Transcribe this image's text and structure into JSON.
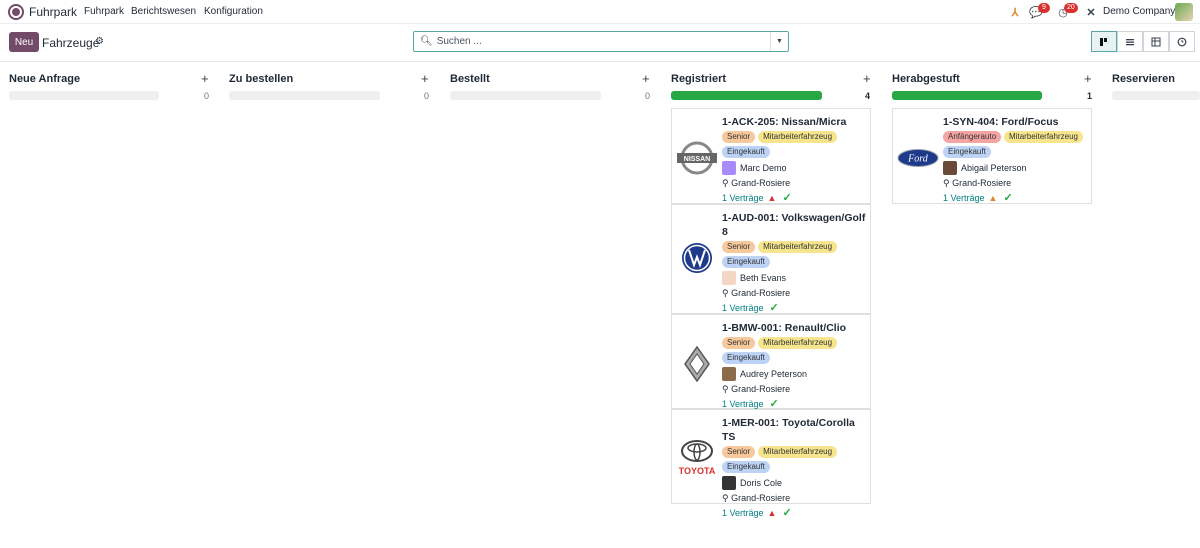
{
  "app": {
    "name": "Fuhrpark",
    "logo_icon": "steering-wheel-icon",
    "brand_color": "#714B67"
  },
  "menu": [
    "Fuhrpark",
    "Berichtswesen",
    "Konfiguration"
  ],
  "systray": {
    "messages_badge": "9",
    "activities_badge": "20",
    "company": "Demo Company"
  },
  "control_panel": {
    "new_label": "Neu",
    "title": "Fahrzeuge",
    "search_placeholder": "Suchen ..."
  },
  "columns": [
    {
      "title": "Neue Anfrage",
      "count": "0"
    },
    {
      "title": "Zu bestellen",
      "count": "0"
    },
    {
      "title": "Bestellt",
      "count": "0"
    },
    {
      "title": "Registriert",
      "count": "4"
    },
    {
      "title": "Herabgestuft",
      "count": "1"
    },
    {
      "title": "Reservieren"
    }
  ],
  "registriert_cards": [
    {
      "title": "1-ACK-205: Nissan/Micra",
      "brand": "NISSAN",
      "tags": [
        "Senior",
        "Mitarbeiterfahrzeug",
        "Eingekauft"
      ],
      "driver": "Marc Demo",
      "location": "Grand-Rosiere",
      "contracts": "1 Verträge",
      "warning": true
    },
    {
      "title": "1-AUD-001: Volkswagen/Golf 8",
      "brand": "VW",
      "tags": [
        "Senior",
        "Mitarbeiterfahrzeug",
        "Eingekauft"
      ],
      "driver": "Beth Evans",
      "location": "Grand-Rosiere",
      "contracts": "1 Verträge",
      "warning": false
    },
    {
      "title": "1-BMW-001: Renault/Clio",
      "brand": "RENAULT",
      "tags": [
        "Senior",
        "Mitarbeiterfahrzeug",
        "Eingekauft"
      ],
      "driver": "Audrey Peterson",
      "location": "Grand-Rosiere",
      "contracts": "1 Verträge",
      "warning": false
    },
    {
      "title": "1-MER-001: Toyota/Corolla TS",
      "brand": "TOYOTA",
      "tags": [
        "Senior",
        "Mitarbeiterfahrzeug",
        "Eingekauft"
      ],
      "driver": "Doris Cole",
      "location": "Grand-Rosiere",
      "contracts": "1 Verträge",
      "warning": true
    }
  ],
  "herabgestuft_cards": [
    {
      "title": "1-SYN-404: Ford/Focus",
      "brand": "Ford",
      "tags": [
        "Anfängerauto",
        "Mitarbeiterfahrzeug",
        "Eingekauft"
      ],
      "driver": "Abigail Peterson",
      "location": "Grand-Rosiere",
      "contracts": "1 Verträge",
      "warning": true
    }
  ]
}
